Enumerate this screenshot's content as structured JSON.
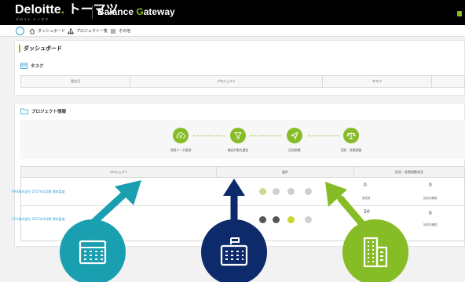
{
  "header": {
    "brand": "Deloitte",
    "brand_dot": ".",
    "brand_jp": " トーマツ",
    "brand_sub": "デロイト トーマツ",
    "product_first": "Balance ",
    "product_g": "G",
    "product_rest": "ateway"
  },
  "nav": {
    "items": [
      {
        "label": "ダッシュボード",
        "icon": "home-icon"
      },
      {
        "label": "プロジェクト一覧",
        "icon": "org-chart-icon"
      },
      {
        "label": "その他",
        "icon": "menu-icon"
      }
    ]
  },
  "dashboard": {
    "title": "ダッシュボード",
    "task_section": {
      "title": "タスク",
      "columns": [
        "発生日",
        "プロジェクト",
        "タスク"
      ]
    },
    "project_section": {
      "title": "プロジェクト情報",
      "steps": [
        {
          "label": "残高データ登録",
          "icon": "upload-cloud-icon"
        },
        {
          "label": "確認対象先選定",
          "icon": "filter-icon"
        },
        {
          "label": "回収依頼",
          "icon": "send-icon"
        },
        {
          "label": "回収・差異調整",
          "icon": "scale-icon"
        }
      ],
      "columns": [
        "プロジェクト",
        "進捗",
        "回収・差異調整状況"
      ],
      "rows": [
        {
          "name": "AAA株式会社 2017年3月期 期末監査",
          "count1": "0",
          "count1_label": "発送済",
          "count2": "0",
          "count2_label": "回収未確認"
        },
        {
          "name": "CCC株式会社 2017年3月期 期末監査",
          "count1": "50",
          "count1_label": "発送済",
          "count2": "0",
          "count2_label": "回収未確認"
        }
      ]
    }
  },
  "colors": {
    "accent_green": "#86bc25",
    "teal": "#1a9fb0",
    "navy": "#0d2a6b",
    "link_blue": "#2a9fd6"
  }
}
